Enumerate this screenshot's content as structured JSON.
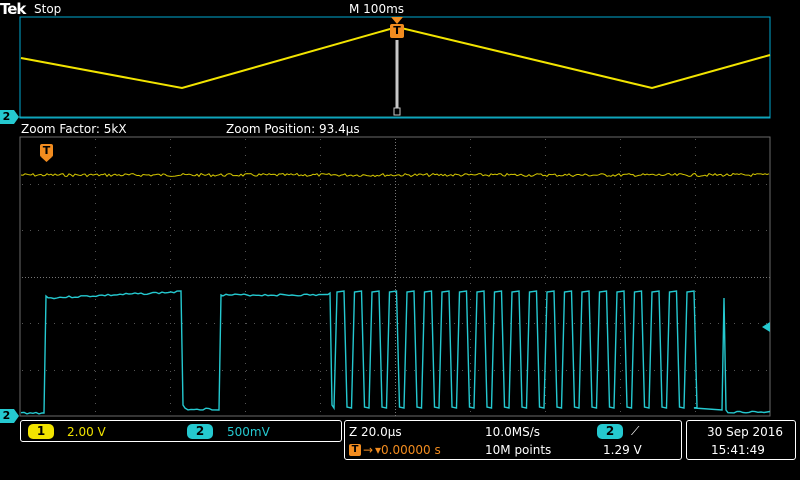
{
  "brand": "Tek",
  "run_state": "Stop",
  "timebase": "M 100ms",
  "zoom": {
    "factor_label": "Zoom Factor: 5kX",
    "position_label": "Zoom Position: 93.4μs",
    "timebase": "Z 20.0μs"
  },
  "trigger_marker": "T",
  "channels": [
    {
      "id": "1",
      "scale": "2.00 V",
      "color": "#f2e400"
    },
    {
      "id": "2",
      "scale": "500mV",
      "color": "#25c9d0"
    }
  ],
  "marker_ch2": "2",
  "acquisition": {
    "sample_rate": "10.0MS/s",
    "record_length": "10M points",
    "trigger_delay": "▾0.00000 s",
    "trigger_channel": "2",
    "trigger_slope": "⟋",
    "trigger_level": "1.29 V"
  },
  "datetime": {
    "date": "30 Sep 2016",
    "time": "15:41:49"
  },
  "colors": {
    "ch1": "#f2e400",
    "ch2": "#25c9d0",
    "trigger": "#f28c1f",
    "zoom_box": "#c8c8c8"
  }
}
